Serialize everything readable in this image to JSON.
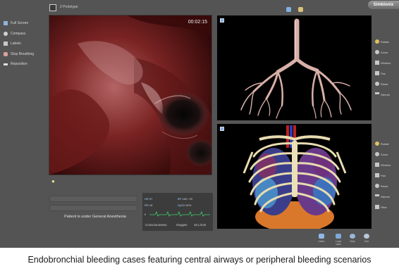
{
  "topbar": {
    "title": "2 Prototype",
    "logo": "Simbionix"
  },
  "side_menu": [
    {
      "label": "Full Screen",
      "icon": "fullscreen-icon"
    },
    {
      "label": "Compass",
      "icon": "compass-icon"
    },
    {
      "label": "Labels",
      "icon": "labels-icon"
    },
    {
      "label": "Stop Breathing",
      "icon": "lungs-icon"
    },
    {
      "label": "Reposition",
      "icon": "reposition-icon"
    }
  ],
  "video": {
    "timer": "00:02:15"
  },
  "status": {
    "text": "Patient is under General Anesthesia"
  },
  "vitals": {
    "rows": [
      {
        "k1": "HR",
        "v1": "97",
        "k2": "BP",
        "v2": "160 / 99"
      },
      {
        "k1": "RR",
        "v1": "18",
        "k2": "SpO2",
        "v2": "82%"
      }
    ],
    "ecg_label": "II",
    "consciousness_label": "Consciousness",
    "oxygen_label": "Oxygen",
    "oxygen_value": "10 L/min"
  },
  "tools_top": [
    {
      "label": "Rotate",
      "icon": "rotate-icon"
    },
    {
      "label": "Zoom",
      "icon": "zoom-icon"
    },
    {
      "label": "Window",
      "icon": "window-icon"
    },
    {
      "label": "Pan",
      "icon": "pan-icon"
    },
    {
      "label": "Reset",
      "icon": "reset-icon"
    },
    {
      "label": "Sternal",
      "icon": "sternal-icon"
    }
  ],
  "tools_bottom": [
    {
      "label": "Rotate",
      "icon": "rotate-icon"
    },
    {
      "label": "Zoom",
      "icon": "zoom-icon"
    },
    {
      "label": "Window",
      "icon": "window-icon"
    },
    {
      "label": "Pan",
      "icon": "pan-icon"
    },
    {
      "label": "Reset",
      "icon": "reset-icon"
    },
    {
      "label": "Sternal",
      "icon": "sternal-icon"
    },
    {
      "label": "Filter",
      "icon": "filter-icon"
    }
  ],
  "bottom_icons": [
    {
      "label": "Video",
      "icon": "video-icon"
    },
    {
      "label": "Load case",
      "icon": "folder-icon"
    },
    {
      "label": "Help",
      "icon": "help-icon"
    },
    {
      "label": "Exit",
      "icon": "exit-icon"
    }
  ],
  "caption": "Endobronchial bleeding cases featuring central airways or peripheral bleeding scenarios"
}
